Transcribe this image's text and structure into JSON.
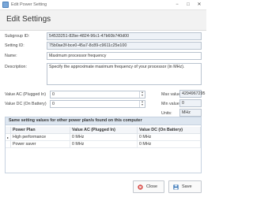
{
  "window": {
    "title": "Edit Power Setting",
    "minimize_glyph": "−",
    "maximize_glyph": "□",
    "close_glyph": "✕"
  },
  "header": {
    "title": "Edit Settings"
  },
  "form": {
    "subgroup_id": {
      "label": "Subgroup ID:",
      "value": "54533251-82be-4824-96c1-47b60b740d00"
    },
    "setting_id": {
      "label": "Setting ID:",
      "value": "75b0ae3f-bce0-45a7-8c89-c9611c25e100"
    },
    "name": {
      "label": "Name:",
      "value": "Maximum processor frequency"
    },
    "description": {
      "label": "Description:",
      "value": "Specify the approximate maximum frequency of your processor (in MHz)."
    },
    "value_ac": {
      "label": "Value AC (Plugged In)",
      "value": "0"
    },
    "value_dc": {
      "label": "Value DC (On Battery)",
      "value": "0"
    },
    "max_value": {
      "label": "Max value:",
      "value": "4294967295"
    },
    "min_value": {
      "label": "Min value:",
      "value": "0"
    },
    "units": {
      "label": "Units:",
      "value": "MHz"
    }
  },
  "plans": {
    "title": "Same setting values for other power plan/s found on this computer",
    "columns": [
      "Power Plan",
      "Value AC (Plugged In)",
      "Value DC (On Battery)"
    ],
    "rows": [
      {
        "plan": "High performance",
        "ac": "0 MHz",
        "dc": "0 MHz",
        "current": true
      },
      {
        "plan": "Power saver",
        "ac": "0 MHz",
        "dc": "0 MHz",
        "current": false
      }
    ],
    "current_row_marker": "▸"
  },
  "buttons": {
    "close": "Close",
    "save": "Save"
  },
  "colors": {
    "close_icon": "#d9534f",
    "save_icon": "#2f6fb3",
    "header_bg": "#f2f2f2",
    "group_header_bg": "#dde6f0"
  },
  "icons": {
    "close_button": "x-circle-icon",
    "save_button": "floppy-disk-icon"
  }
}
